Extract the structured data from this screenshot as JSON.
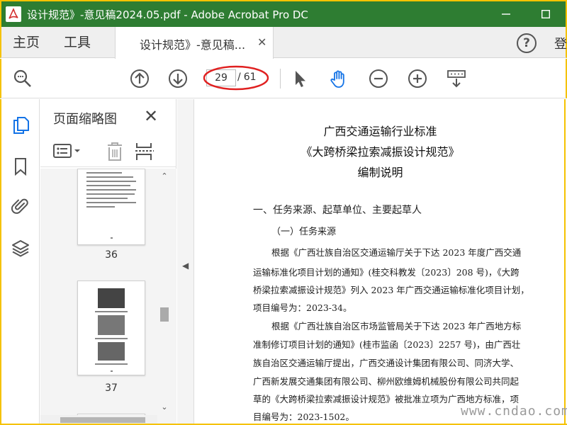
{
  "window": {
    "title": "设计规范》-意见稿2024.05.pdf - Adobe Acrobat Pro DC"
  },
  "tabs": {
    "home": "主页",
    "tools": "工具",
    "document": "设计规范》-意见稿...",
    "clipped": "登",
    "help": "?"
  },
  "toolbar": {
    "current_page": "29",
    "separator": "/",
    "total_pages": "61"
  },
  "thumbnails": {
    "title": "页面缩略图",
    "pages": [
      {
        "label": "36"
      },
      {
        "label": "37"
      }
    ]
  },
  "document": {
    "headings": [
      "广西交通运输行业标准",
      "《大跨桥梁拉索减振设计规范》",
      "编制说明"
    ],
    "lines": [
      "一、任务来源、起草单位、主要起草人",
      "（一）任务来源",
      "根据《广西壮族自治区交通运输厅关于下达 2023 年度广西交通",
      "运输标准化项目计划的通知》(桂交科教发〔2023〕208 号)，《大跨",
      "桥梁拉索减振设计规范》列入 2023 年广西交通运输标准化项目计划，",
      "项目编号为：2023-34。",
      "根据《广西壮族自治区市场监管局关于下达 2023 年广西地方标",
      "准制修订项目计划的通知》(桂市监函〔2023〕2257 号)，由广西壮",
      "族自治区交通运输厅提出，广西交通设计集团有限公司、同济大学、",
      "广西新发展交通集团有限公司、柳州欧维姆机械股份有限公司共同起",
      "草的《大跨桥梁拉索减振设计规范》被批准立项为广西地方标准，项",
      "目编号为：2023-1502。"
    ]
  },
  "watermark": "www.cndao.com",
  "colors": {
    "titlebar": "#2e7d32",
    "frame": "#f5c200",
    "accent_blue": "#1473e6",
    "annotation_red": "#e02020"
  }
}
